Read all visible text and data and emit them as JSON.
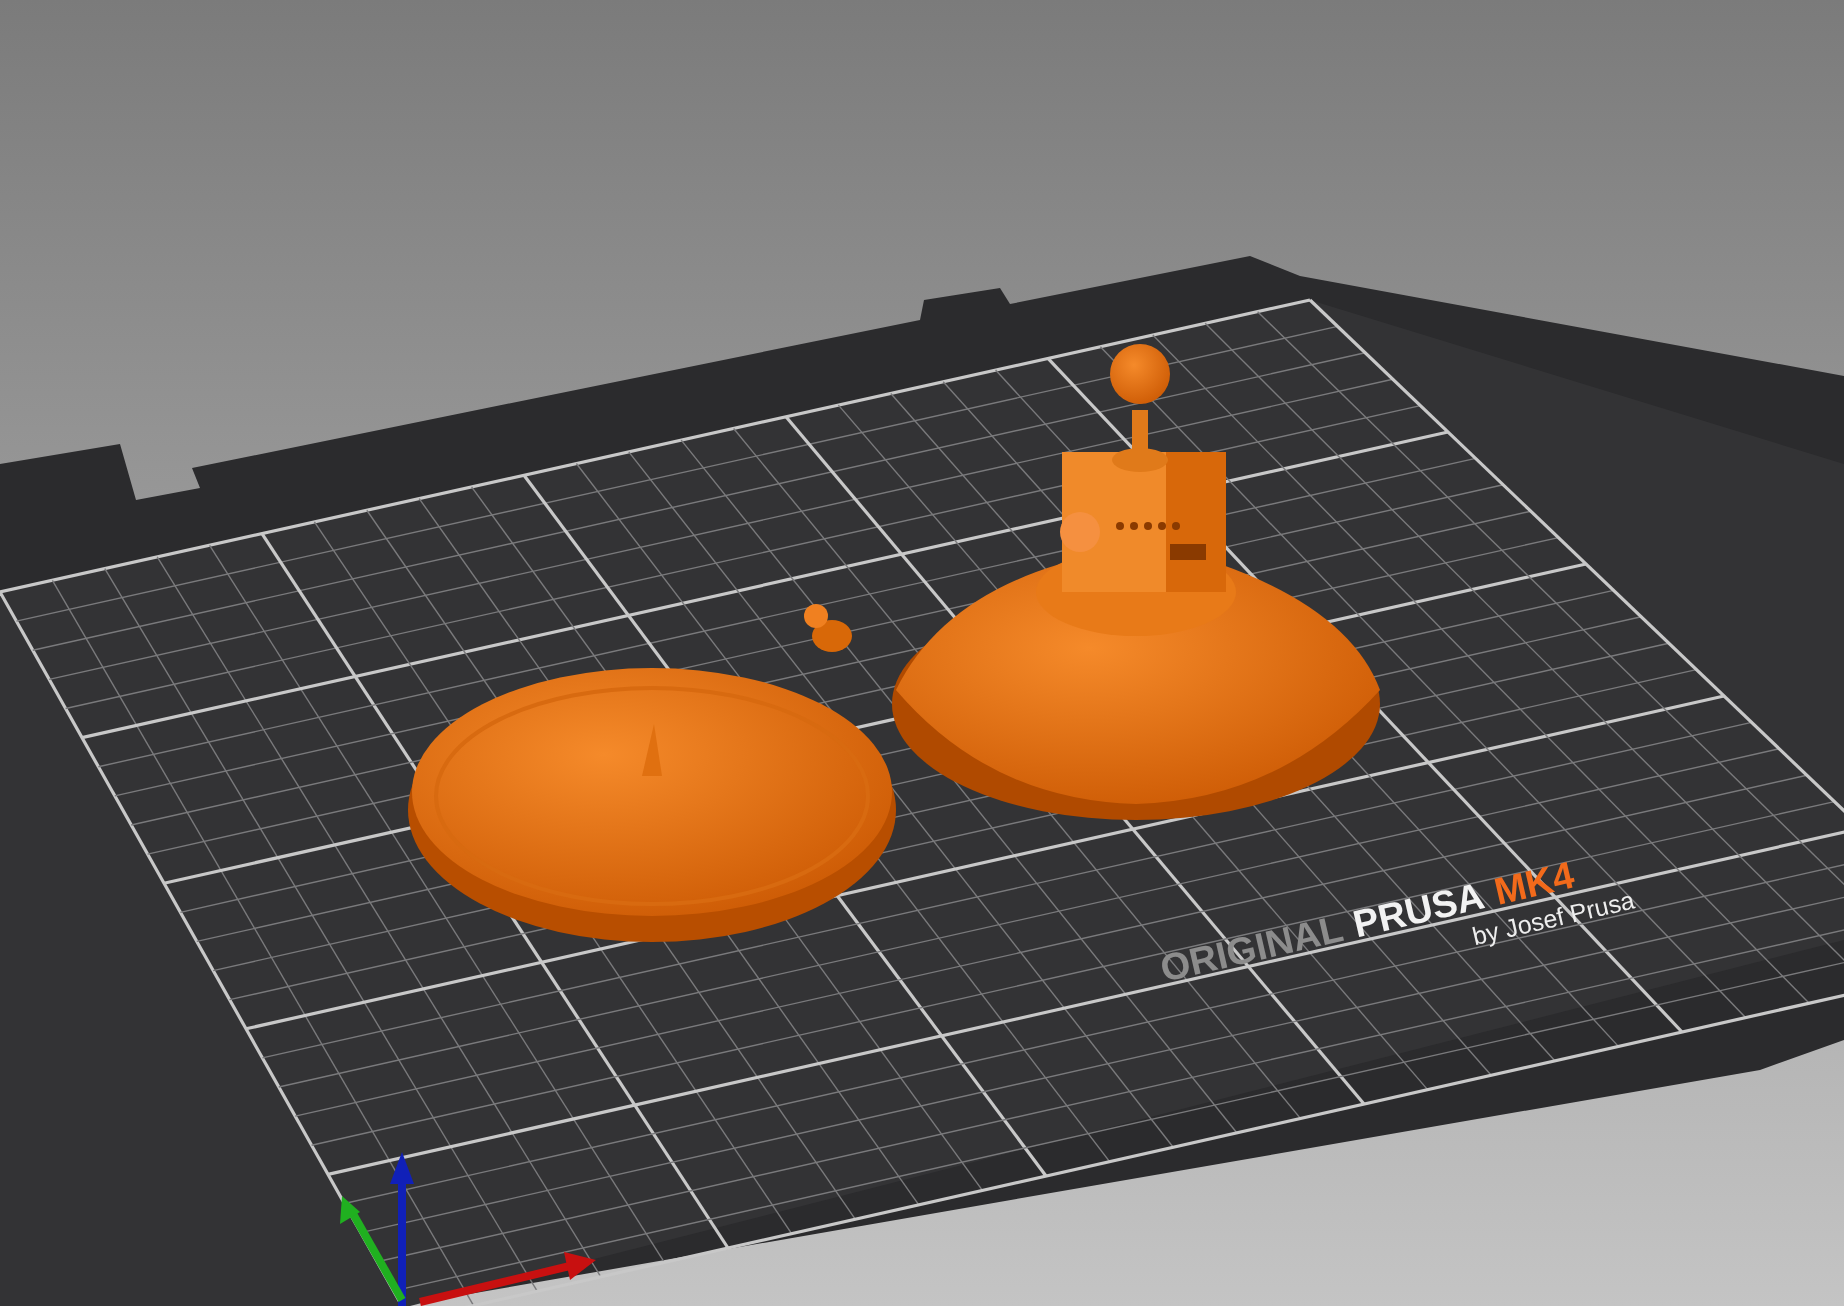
{
  "bed_logo": [
    {
      "text": "ORIGINAL",
      "kind": "muted"
    },
    {
      "text": "PRUSA",
      "kind": "strong"
    },
    {
      "text": "MK4",
      "kind": "accent"
    }
  ],
  "bed_tagline": "by Josef Prusa"
}
